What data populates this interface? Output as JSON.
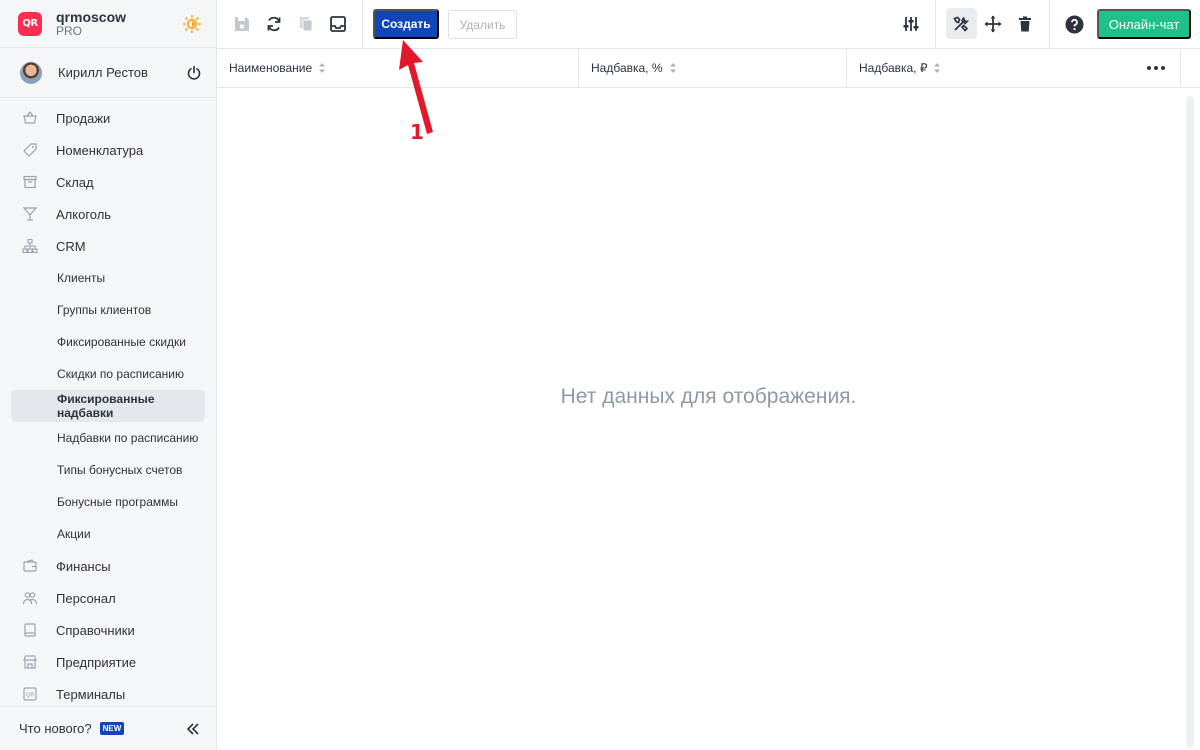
{
  "brand": {
    "logo_text": "QR",
    "name": "qrmoscow",
    "plan": "PRO"
  },
  "user": {
    "name": "Кирилл Рестов"
  },
  "sidebar": {
    "items": [
      {
        "label": "Продажи",
        "icon": "basket-icon"
      },
      {
        "label": "Номенклатура",
        "icon": "tag-icon"
      },
      {
        "label": "Склад",
        "icon": "archive-icon"
      },
      {
        "label": "Алкоголь",
        "icon": "cocktail-glass-icon"
      },
      {
        "label": "CRM",
        "icon": "hierarchy-icon"
      }
    ],
    "crm_subitems": [
      {
        "label": "Клиенты",
        "active": false
      },
      {
        "label": "Группы клиентов",
        "active": false
      },
      {
        "label": "Фиксированные скидки",
        "active": false
      },
      {
        "label": "Скидки по расписанию",
        "active": false
      },
      {
        "label": "Фиксированные надбавки",
        "active": true
      },
      {
        "label": "Надбавки по расписанию",
        "active": false
      },
      {
        "label": "Типы бонусных счетов",
        "active": false
      },
      {
        "label": "Бонусные программы",
        "active": false
      },
      {
        "label": "Акции",
        "active": false
      }
    ],
    "bottom_items": [
      {
        "label": "Финансы",
        "icon": "wallet-icon"
      },
      {
        "label": "Персонал",
        "icon": "people-icon"
      },
      {
        "label": "Справочники",
        "icon": "book-icon"
      },
      {
        "label": "Предприятие",
        "icon": "store-icon"
      },
      {
        "label": "Терминалы",
        "icon": "terminal-qr-icon"
      }
    ],
    "footer": {
      "whats_new": "Что нового?",
      "badge": "NEW"
    }
  },
  "toolbar": {
    "create_label": "Создать",
    "delete_label": "Удалить",
    "chat_label": "Онлайн-чат"
  },
  "grid": {
    "columns": [
      "Наименование",
      "Надбавка, %",
      "Надбавка, ₽"
    ],
    "empty_message": "Нет данных для отображения."
  },
  "annotation": {
    "number": "1"
  },
  "colors": {
    "primary": "#1246b8",
    "chat": "#1fc18a",
    "brand": "#ff2d4f",
    "annotation": "#e2182c"
  }
}
